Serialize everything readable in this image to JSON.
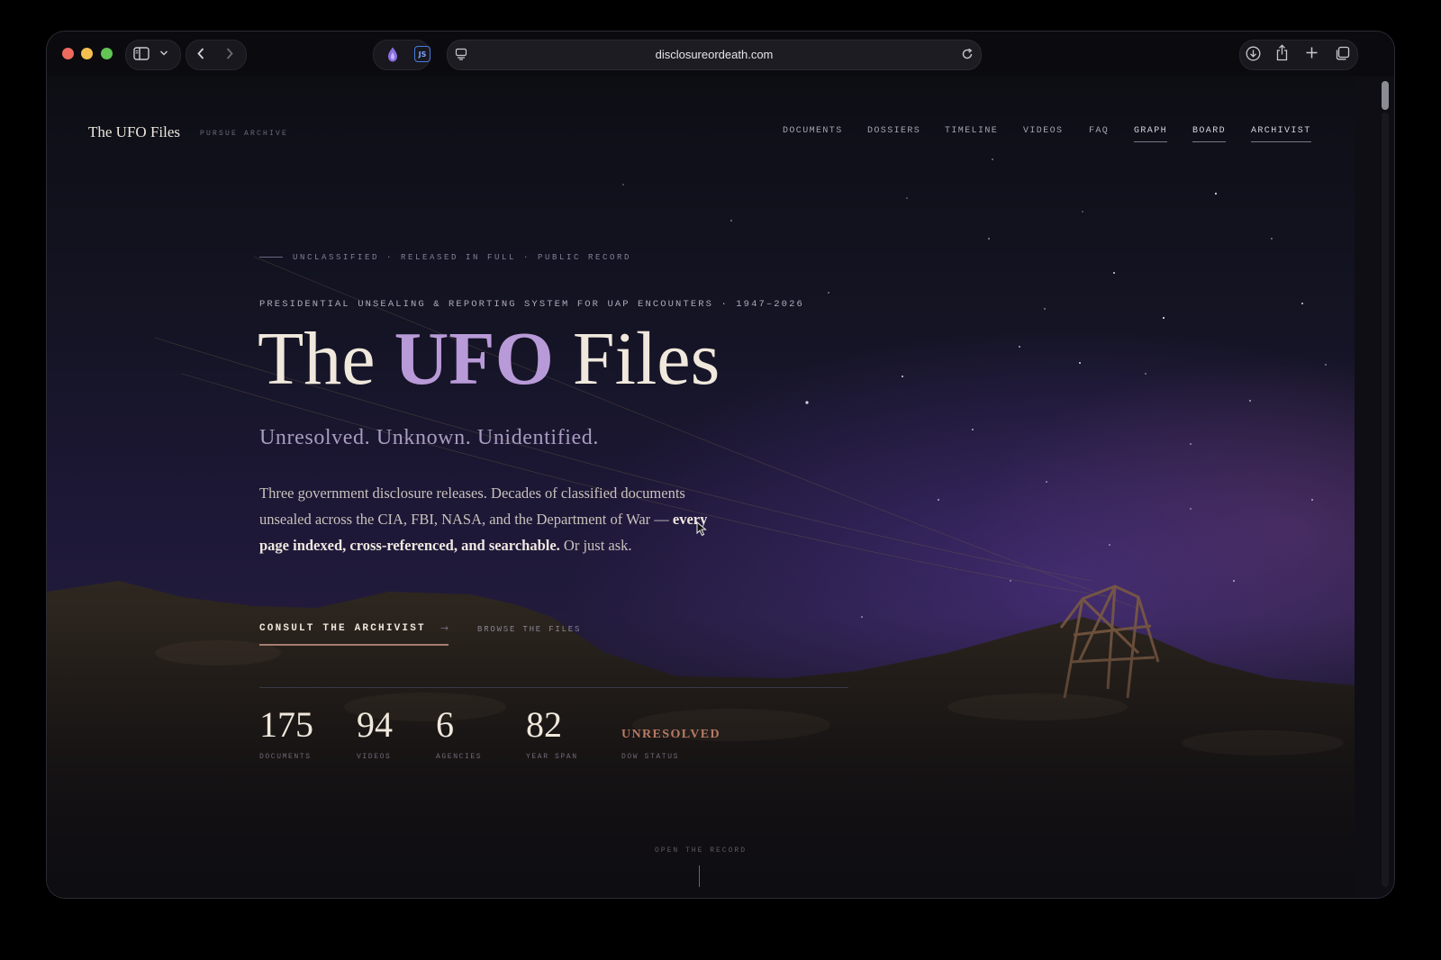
{
  "browser": {
    "url": "disclosureordeath.com",
    "icons": [
      "sidebar-icon",
      "chevron-down-icon",
      "back-icon",
      "forward-icon",
      "extension-icon",
      "js-extension-icon",
      "page-settings-icon",
      "reload-icon",
      "download-icon",
      "share-icon",
      "new-tab-icon",
      "tabs-overview-icon"
    ],
    "js_badge": "JS"
  },
  "site": {
    "brand": "The UFO Files",
    "brand_sub": "PURSUE ARCHIVE",
    "nav": [
      {
        "label": "DOCUMENTS",
        "active": false
      },
      {
        "label": "DOSSIERS",
        "active": false
      },
      {
        "label": "TIMELINE",
        "active": false
      },
      {
        "label": "VIDEOS",
        "active": false
      },
      {
        "label": "FAQ",
        "active": false
      },
      {
        "label": "GRAPH",
        "active": true
      },
      {
        "label": "BOARD",
        "active": true
      },
      {
        "label": "ARCHIVIST",
        "active": true
      }
    ]
  },
  "hero": {
    "eyebrow": "UNCLASSIFIED · RELEASED IN FULL · PUBLIC RECORD",
    "kicker": "PRESIDENTIAL UNSEALING & REPORTING SYSTEM FOR UAP ENCOUNTERS · 1947–2026",
    "title_pre": "The ",
    "title_accent": "UFO",
    "title_post": " Files",
    "tagline": "Unresolved. Unknown. Unidentified.",
    "lede_start": "Three government disclosure releases. Decades of classified documents unsealed across the CIA, FBI, NASA, and the Department of War — ",
    "lede_bold": "every page indexed, cross-referenced, and searchable.",
    "lede_end": " Or just ask.",
    "cta_primary": "CONSULT THE ARCHIVIST",
    "cta_arrow": "→",
    "cta_secondary": "BROWSE THE FILES"
  },
  "stats": [
    {
      "value": "175",
      "label": "DOCUMENTS"
    },
    {
      "value": "94",
      "label": "VIDEOS"
    },
    {
      "value": "6",
      "label": "AGENCIES"
    },
    {
      "value": "82",
      "label": "YEAR SPAN"
    },
    {
      "value": "UNRESOLVED",
      "label": "DOW STATUS"
    }
  ],
  "footer_hint": "OPEN THE RECORD",
  "colors": {
    "accent": "#b99ad8",
    "status": "#b77a64",
    "cta_underline": "#a77e70",
    "text": "#f0e8dc"
  }
}
